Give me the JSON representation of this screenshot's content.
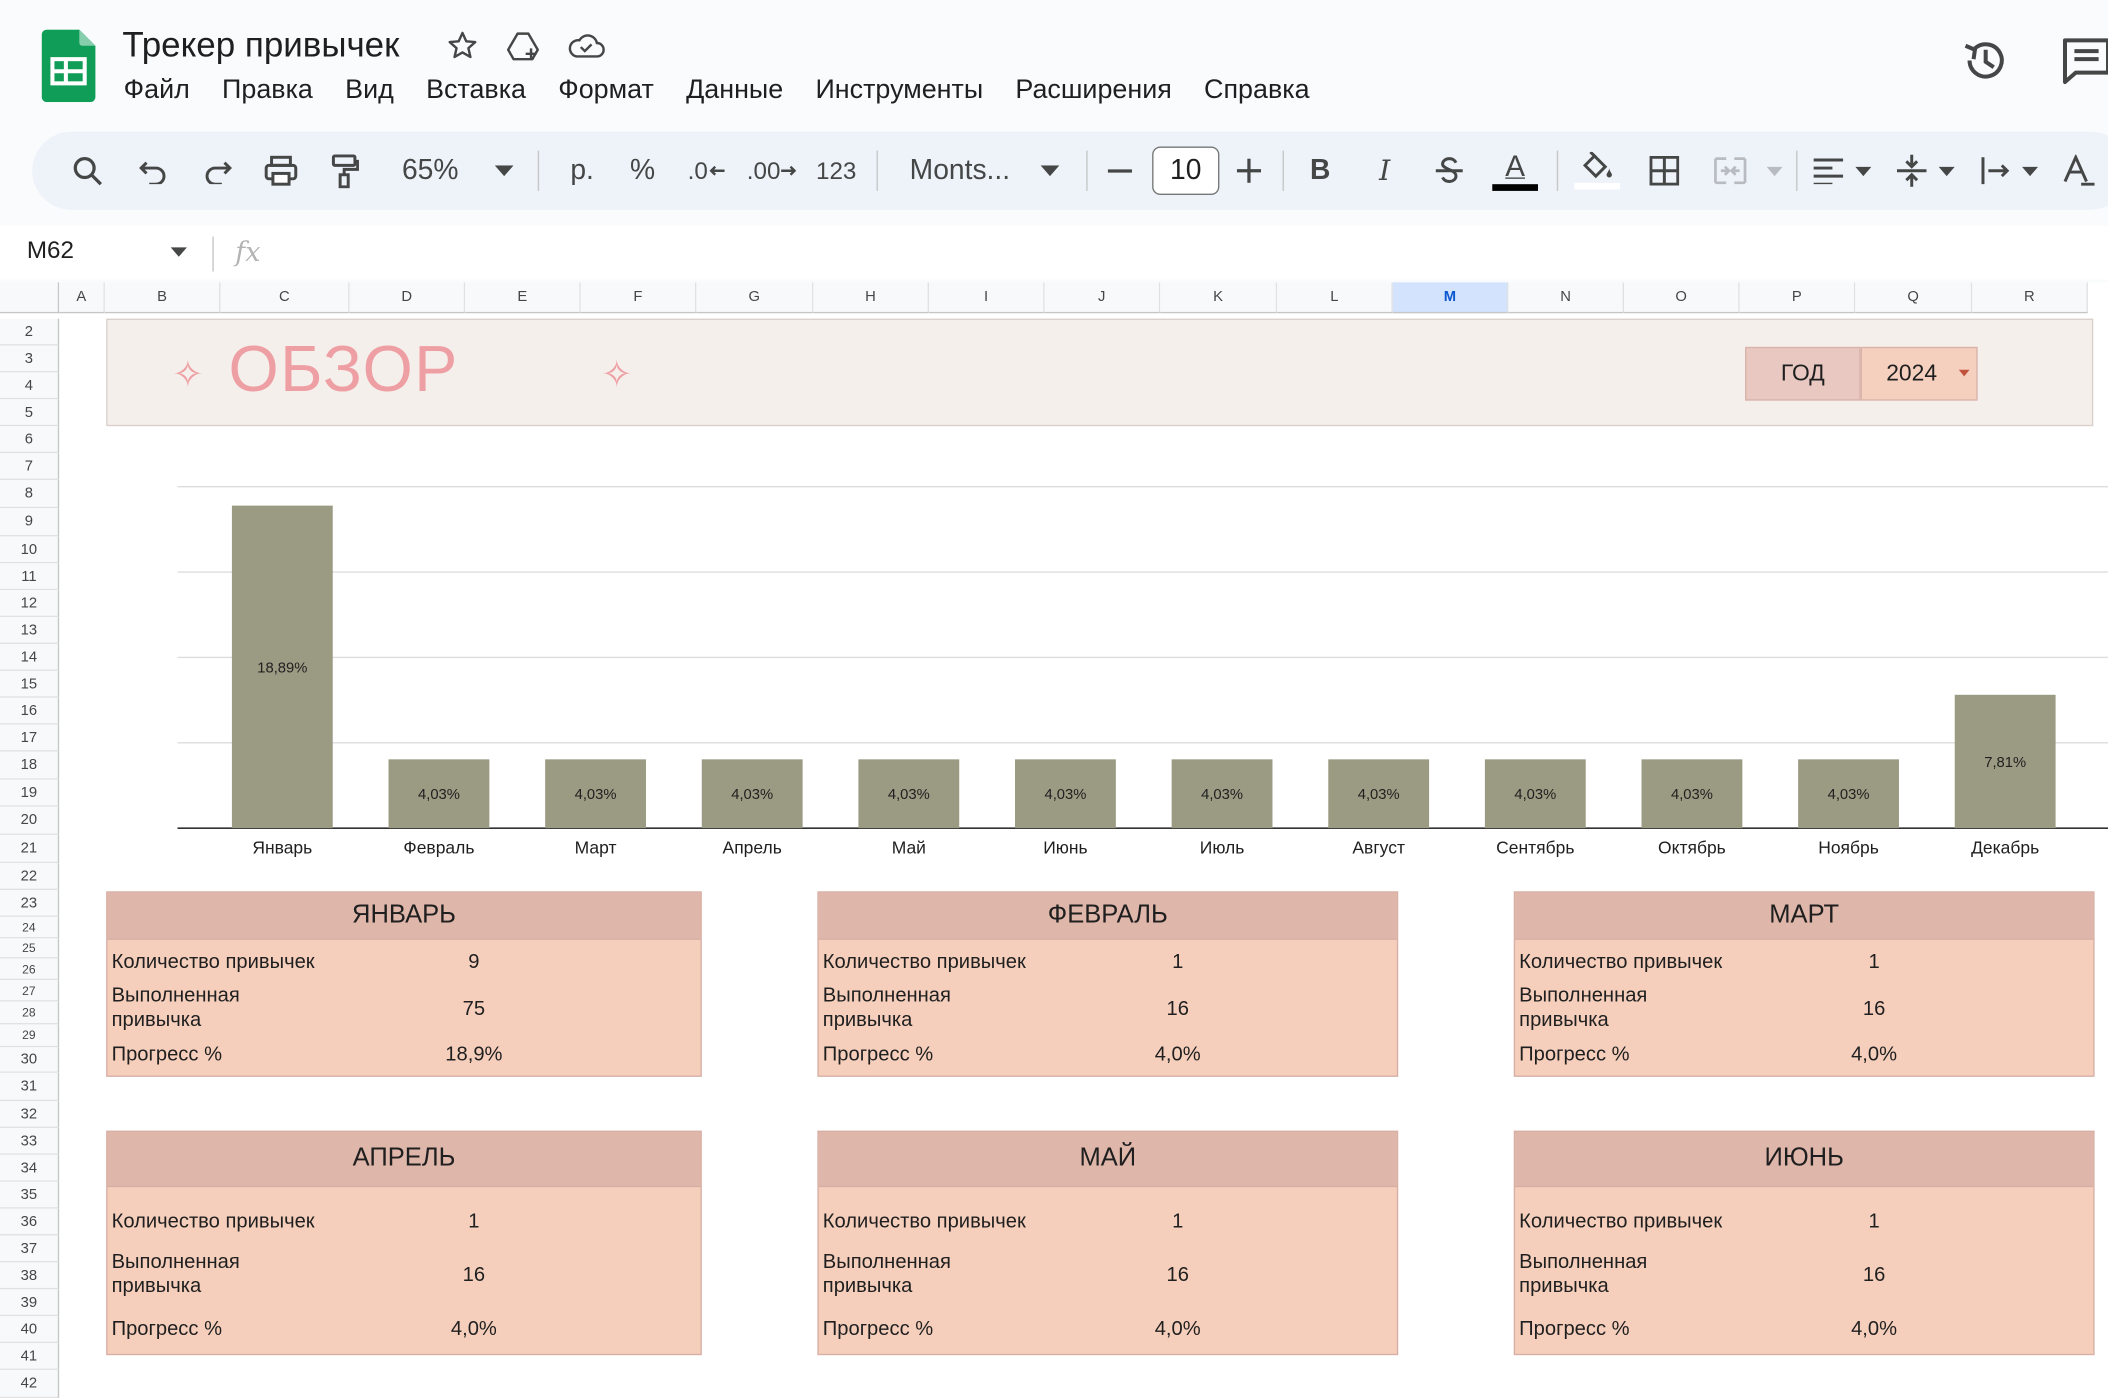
{
  "app": {
    "doc_title": "Трекер привычек",
    "menu": [
      "Файл",
      "Правка",
      "Вид",
      "Вставка",
      "Формат",
      "Данные",
      "Инструменты",
      "Расширения",
      "Справка"
    ]
  },
  "toolbar": {
    "zoom": "65%",
    "currency": "р.",
    "percent": "%",
    "dec_decrease": ".0",
    "dec_increase": ".00",
    "number_format": "123",
    "font": "Monts...",
    "font_size": "10",
    "bold": "B",
    "italic": "I",
    "text_color_glyph": "A"
  },
  "formula_bar": {
    "cell_ref": "M62",
    "fx": "fx"
  },
  "columns": [
    "A",
    "B",
    "C",
    "D",
    "E",
    "F",
    "G",
    "H",
    "I",
    "J",
    "K",
    "L",
    "M",
    "N",
    "O",
    "P",
    "Q",
    "R"
  ],
  "selected_column": "M",
  "rows": [
    "2",
    "3",
    "4",
    "5",
    "6",
    "7",
    "8",
    "9",
    "10",
    "11",
    "12",
    "13",
    "14",
    "15",
    "16",
    "17",
    "18",
    "19",
    "20",
    "21",
    "22",
    "23",
    "24",
    "25",
    "26",
    "27",
    "28",
    "29",
    "30",
    "31",
    "32",
    "33",
    "34",
    "35",
    "36",
    "37",
    "38",
    "39",
    "40",
    "41",
    "42"
  ],
  "overview": {
    "title": "ОБЗОР",
    "year_label": "ГОД",
    "year_value": "2024"
  },
  "chart_data": {
    "type": "bar",
    "categories": [
      "Январь",
      "Февраль",
      "Март",
      "Апрель",
      "Май",
      "Июнь",
      "Июль",
      "Август",
      "Сентябрь",
      "Октябрь",
      "Ноябрь",
      "Декабрь"
    ],
    "values": [
      18.89,
      4.03,
      4.03,
      4.03,
      4.03,
      4.03,
      4.03,
      4.03,
      4.03,
      4.03,
      4.03,
      7.81
    ],
    "data_labels": [
      "18,89%",
      "4,03%",
      "4,03%",
      "4,03%",
      "4,03%",
      "4,03%",
      "4,03%",
      "4,03%",
      "4,03%",
      "4,03%",
      "4,03%",
      "7,81%"
    ],
    "ylim": [
      0,
      20
    ],
    "grid": true,
    "bar_color": "#9b9b84"
  },
  "cards": [
    {
      "month": "ЯНВАРЬ",
      "labels": [
        "Количество привычек",
        "Выполненная привычка",
        "Прогресс %"
      ],
      "values": [
        "9",
        "75",
        "18,9%"
      ]
    },
    {
      "month": "ФЕВРАЛЬ",
      "labels": [
        "Количество привычек",
        "Выполненная привычка",
        "Прогресс %"
      ],
      "values": [
        "1",
        "16",
        "4,0%"
      ]
    },
    {
      "month": "МАРТ",
      "labels": [
        "Количество привычек",
        "Выполненная привычка",
        "Прогресс %"
      ],
      "values": [
        "1",
        "16",
        "4,0%"
      ]
    },
    {
      "month": "АПРЕЛЬ",
      "labels": [
        "Количество привычек",
        "Выполненная привычка",
        "Прогресс %"
      ],
      "values": [
        "1",
        "16",
        "4,0%"
      ]
    },
    {
      "month": "МАЙ",
      "labels": [
        "Количество привычек",
        "Выполненная привычка",
        "Прогресс %"
      ],
      "values": [
        "1",
        "16",
        "4,0%"
      ]
    },
    {
      "month": "ИЮНЬ",
      "labels": [
        "Количество привычек",
        "Выполненная привычка",
        "Прогресс %"
      ],
      "values": [
        "1",
        "16",
        "4,0%"
      ]
    }
  ],
  "colors": {
    "accent_pink": "#ee9fa3",
    "card_fill": "#f5cfbc",
    "card_header": "#dfb6aa",
    "banner_fill": "#f5efeb",
    "sheets_green": "#0f9d58"
  },
  "icons": [
    "sheets-logo-icon",
    "star-icon",
    "move-to-drive-icon",
    "cloud-saved-icon",
    "history-icon",
    "comment-icon",
    "search-icon",
    "undo-icon",
    "redo-icon",
    "print-icon",
    "paint-format-icon",
    "bold-icon",
    "italic-icon",
    "strikethrough-icon",
    "text-color-icon",
    "fill-color-icon",
    "borders-icon",
    "merge-cells-icon",
    "align-left-icon",
    "vertical-align-icon",
    "text-wrap-icon",
    "text-rotate-icon"
  ]
}
